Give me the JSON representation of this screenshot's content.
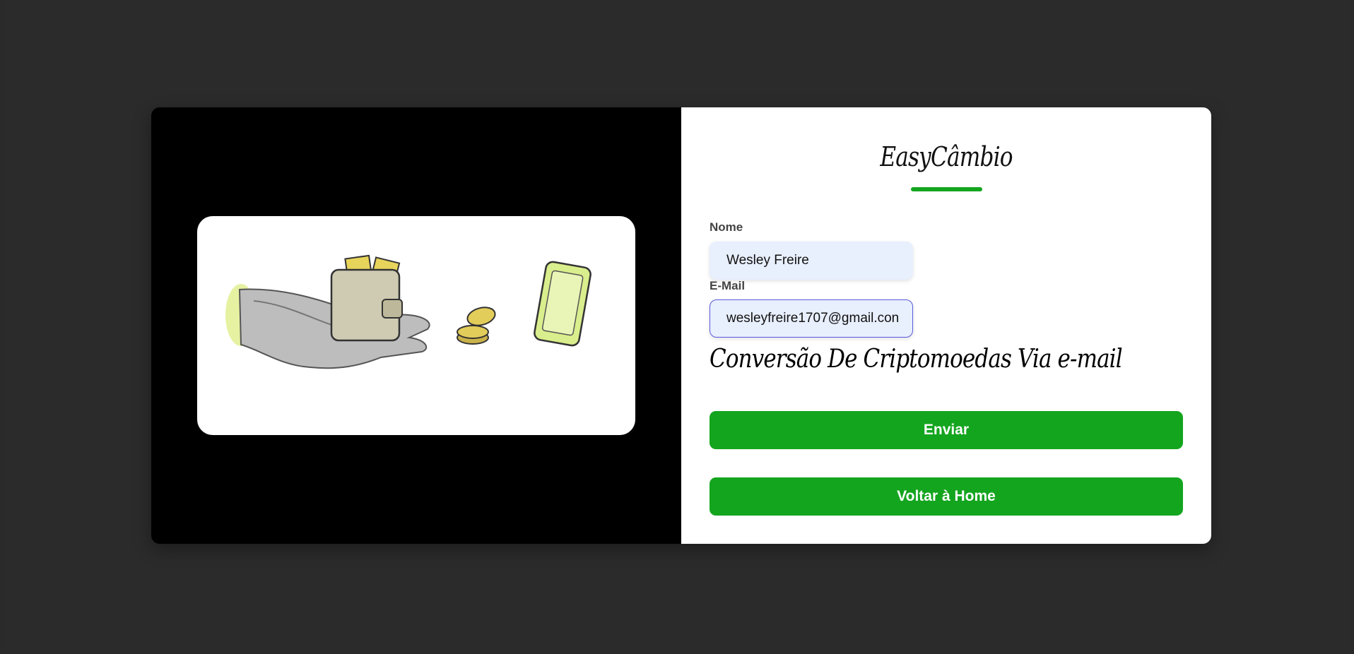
{
  "brand": {
    "name": "EasyCâmbio",
    "accent_color": "#14a51f"
  },
  "form": {
    "name_label": "Nome",
    "name_value": "Wesley Freire",
    "email_label": "E-Mail",
    "email_value": "wesleyfreire1707@gmail.con"
  },
  "tagline": "Conversão De Criptomoedas Via e-mail",
  "buttons": {
    "send": "Enviar",
    "back_home": "Voltar à Home"
  },
  "illustration": {
    "icons": [
      "hand-icon",
      "wallet-icon",
      "coins-icon",
      "smartphone-icon"
    ]
  }
}
